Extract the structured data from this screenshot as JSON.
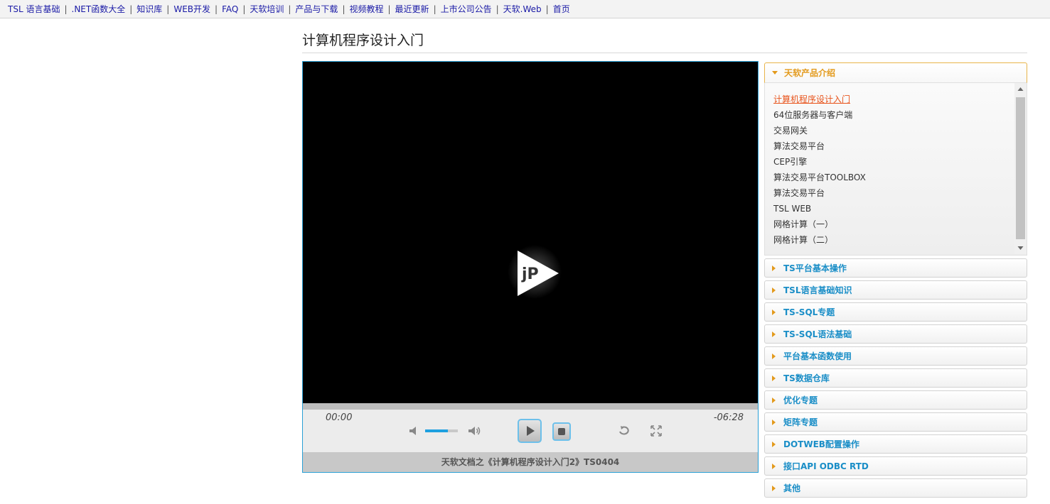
{
  "nav": {
    "items": [
      "TSL 语言基础",
      ".NET函数大全",
      "知识库",
      "WEB开发",
      "FAQ",
      "天软培训",
      "产品与下载",
      "视频教程",
      "最近更新",
      "上市公司公告",
      "天软.Web",
      "首页"
    ],
    "separator": "|"
  },
  "page": {
    "title": "计算机程序设计入门"
  },
  "player": {
    "time_elapsed": "00:00",
    "time_remaining": "-06:28",
    "volume_percent": 70,
    "progress_percent": 0,
    "caption": "天软文档之《计算机程序设计入门2》TS0404",
    "icons": {
      "big_play": "jp-play-logo-icon",
      "mute": "speaker-mute-icon",
      "volume_up": "speaker-volume-icon",
      "play": "play-icon",
      "stop": "stop-icon",
      "loop": "loop-icon",
      "fullscreen": "fullscreen-icon"
    },
    "accent_color": "#1ea0e0"
  },
  "sidebar": {
    "active_panel": {
      "label": "天软产品介绍",
      "items": [
        "计算机程序设计入门",
        "64位服务器与客户端",
        "交易网关",
        "算法交易平台",
        "CEP引擎",
        "算法交易平台TOOLBOX",
        "算法交易平台",
        "TSL WEB",
        "网格计算（一）",
        "网格计算（二）"
      ],
      "current_index": 0
    },
    "panels": [
      "TS平台基本操作",
      "TSL语言基础知识",
      "TS-SQL专题",
      "TS-SQL语法基础",
      "平台基本函数使用",
      "TS数据仓库",
      "优化专题",
      "矩阵专题",
      "DOTWEB配置操作",
      "接口API ODBC RTD",
      "其他"
    ],
    "colors": {
      "active_label": "#e39a1c",
      "panel_label": "#1a8ec7",
      "current_item": "#e8541c"
    }
  }
}
